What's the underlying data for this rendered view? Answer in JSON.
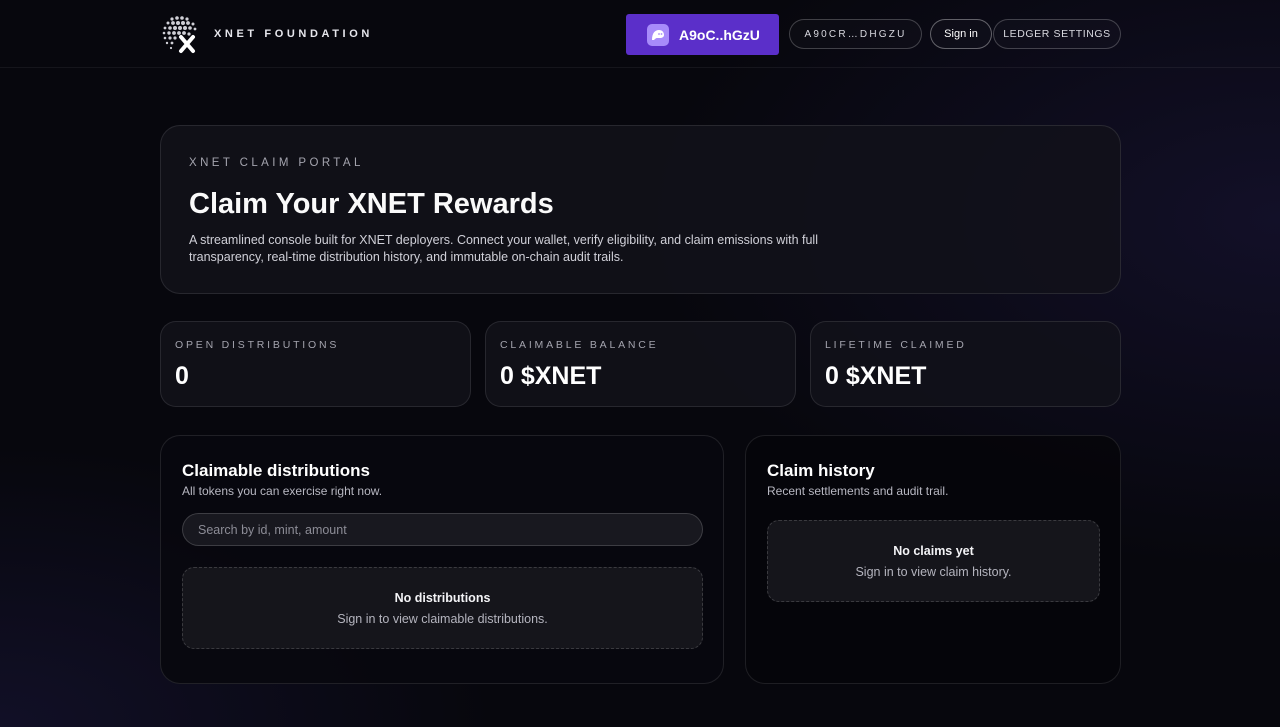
{
  "header": {
    "brand": "XNET FOUNDATION",
    "wallet_button": "A9oC..hGzU",
    "address_pill": "A90CR…DHGZU",
    "sign_in": "Sign in",
    "ledger_settings": "LEDGER SETTINGS",
    "colors": {
      "accent": "#5b2fc9",
      "wallet_icon": "#a78bfa"
    },
    "icons": {
      "logo": "xnet-globe-logo",
      "wallet": "phantom-ghost-icon"
    }
  },
  "hero": {
    "eyebrow": "XNET CLAIM PORTAL",
    "title": "Claim Your XNET Rewards",
    "description": "A streamlined console built for XNET deployers. Connect your wallet, verify eligibility, and claim emissions with full transparency, real-time distribution history, and immutable on-chain audit trails."
  },
  "stats": [
    {
      "label": "OPEN DISTRIBUTIONS",
      "value": "0"
    },
    {
      "label": "CLAIMABLE BALANCE",
      "value": "0 $XNET"
    },
    {
      "label": "LIFETIME CLAIMED",
      "value": "0 $XNET"
    }
  ],
  "claimable": {
    "title": "Claimable distributions",
    "subtitle": "All tokens you can exercise right now.",
    "search_placeholder": "Search by id, mint, amount",
    "empty_title": "No distributions",
    "empty_sub": "Sign in to view claimable distributions."
  },
  "history": {
    "title": "Claim history",
    "subtitle": "Recent settlements and audit trail.",
    "empty_title": "No claims yet",
    "empty_sub": "Sign in to view claim history."
  }
}
